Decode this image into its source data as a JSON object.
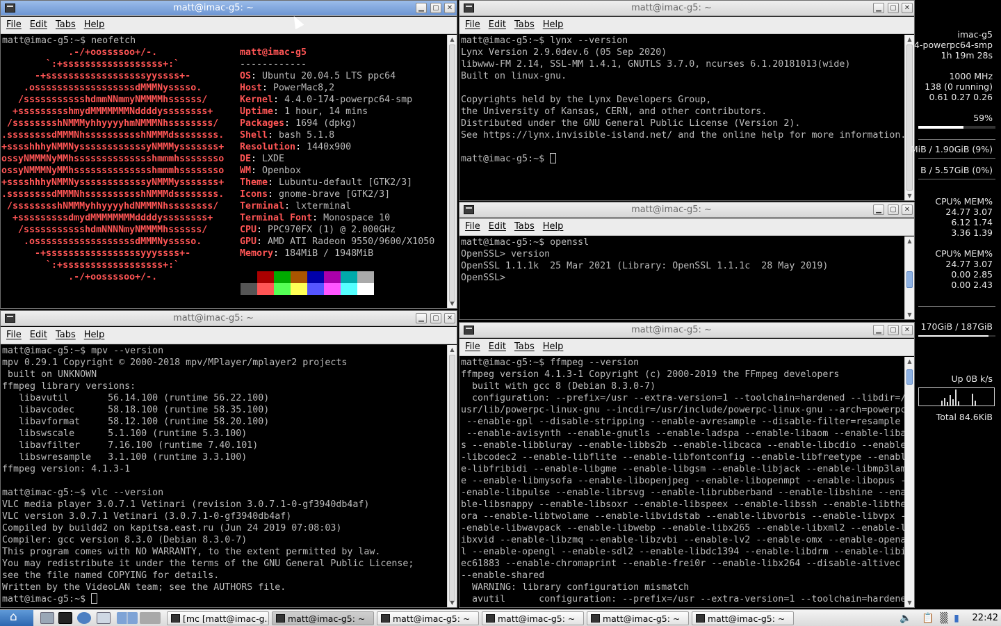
{
  "menu": [
    "File",
    "Edit",
    "Tabs",
    "Help"
  ],
  "windows": {
    "neofetch": {
      "title": "matt@imac-g5: ~",
      "prompt": "matt@imac-g5:~$ neofetch",
      "logo": [
        "             .-/+oossssoo+/-.",
        "         `:+ssssssssssssssssss+:`",
        "       -+ssssssssssssssssssyyssss+-",
        "     .ossssssssssssssssssdMMMNysssso.",
        "    /ssssssssssshdmmNNmmyNMMMMhssssss/",
        "   +ssssssssshmydMMMMMMMNddddyssssssss+",
        "  /sssssssshNMMMyhhyyyyhmNMMMNhssssssss/",
        " .ssssssssdMMMNhsssssssssshNMMMdssssssss.",
        " +sssshhhyNMMNyssssssssssssyNMMMysssssss+",
        " ossyNMMMNyMMhsssssssssssssshmmmhssssssso",
        " ossyNMMMNyMMhsssssssssssssshmmmhssssssso",
        " +sssshhhyNMMNyssssssssssssyNMMMysssssss+",
        " .ssssssssdMMMNhsssssssssshNMMMdssssssss.",
        "  /sssssssshNMMMyhhyyyyhdNMMMNhssssssss/",
        "   +sssssssssdmydMMMMMMMMddddyssssssss+",
        "    /ssssssssssshdmNNNNmyNMMMMhssssss/",
        "     .ossssssssssssssssssdMMMNysssso.",
        "       -+sssssssssssssssssyyyssss+-",
        "         `:+ssssssssssssssssss+:`",
        "             .-/+oossssoo+/-."
      ],
      "user_host": "matt@imac-g5",
      "separator": "------------",
      "info": [
        {
          "label": "OS",
          "value": "Ubuntu 20.04.5 LTS ppc64"
        },
        {
          "label": "Host",
          "value": "PowerMac8,2"
        },
        {
          "label": "Kernel",
          "value": "4.4.0-174-powerpc64-smp"
        },
        {
          "label": "Uptime",
          "value": "1 hour, 14 mins"
        },
        {
          "label": "Packages",
          "value": "1694 (dpkg)"
        },
        {
          "label": "Shell",
          "value": "bash 5.1.8"
        },
        {
          "label": "Resolution",
          "value": "1440x900"
        },
        {
          "label": "DE",
          "value": "LXDE"
        },
        {
          "label": "WM",
          "value": "Openbox"
        },
        {
          "label": "Theme",
          "value": "Lubuntu-default [GTK2/3]"
        },
        {
          "label": "Icons",
          "value": "gnome-brave [GTK2/3]"
        },
        {
          "label": "Terminal",
          "value": "lxterminal"
        },
        {
          "label": "Terminal Font",
          "value": "Monospace 10"
        },
        {
          "label": "CPU",
          "value": "PPC970FX (1) @ 2.000GHz"
        },
        {
          "label": "GPU",
          "value": "AMD ATI Radeon 9550/9600/X1050"
        },
        {
          "label": "Memory",
          "value": "184MiB / 1948MiB"
        }
      ],
      "palette_dark": [
        "#000000",
        "#aa0000",
        "#00aa00",
        "#aa5500",
        "#0000aa",
        "#aa00aa",
        "#00aaaa",
        "#aaaaaa"
      ],
      "palette_bright": [
        "#555555",
        "#ff5555",
        "#55ff55",
        "#ffff55",
        "#5555ff",
        "#ff55ff",
        "#55ffff",
        "#ffffff"
      ]
    },
    "mpv": {
      "title": "matt@imac-g5: ~",
      "text": "matt@imac-g5:~$ mpv --version\nmpv 0.29.1 Copyright © 2000-2018 mpv/MPlayer/mplayer2 projects\n built on UNKNOWN\nffmpeg library versions:\n   libavutil       56.14.100 (runtime 56.22.100)\n   libavcodec      58.18.100 (runtime 58.35.100)\n   libavformat     58.12.100 (runtime 58.20.100)\n   libswscale      5.1.100 (runtime 5.3.100)\n   libavfilter     7.16.100 (runtime 7.40.101)\n   libswresample   3.1.100 (runtime 3.3.100)\nffmpeg version: 4.1.3-1\n\nmatt@imac-g5:~$ vlc --version\nVLC media player 3.0.7.1 Vetinari (revision 3.0.7.1-0-gf3940db4af)\nVLC version 3.0.7.1 Vetinari (3.0.7.1-0-gf3940db4af)\nCompiled by buildd2 on kapitsa.east.ru (Jun 24 2019 07:08:03)\nCompiler: gcc version 8.3.0 (Debian 8.3.0-7)\nThis program comes with NO WARRANTY, to the extent permitted by law.\nYou may redistribute it under the terms of the GNU General Public License;\nsee the file named COPYING for details.\nWritten by the VideoLAN team; see the AUTHORS file.",
      "prompt": "matt@imac-g5:~$ "
    },
    "lynx": {
      "title": "matt@imac-g5: ~",
      "text": "matt@imac-g5:~$ lynx --version\nLynx Version 2.9.0dev.6 (05 Sep 2020)\nlibwww-FM 2.14, SSL-MM 1.4.1, GNUTLS 3.7.0, ncurses 6.1.20181013(wide)\nBuilt on linux-gnu.\n\nCopyrights held by the Lynx Developers Group,\nthe University of Kansas, CERN, and other contributors.\nDistributed under the GNU General Public License (Version 2).\nSee https://lynx.invisible-island.net/ and the online help for more information.\n\n",
      "prompt": "matt@imac-g5:~$ "
    },
    "openssl": {
      "title": "matt@imac-g5: ~",
      "text": "matt@imac-g5:~$ openssl\nOpenSSL> version\nOpenSSL 1.1.1k  25 Mar 2021 (Library: OpenSSL 1.1.1c  28 May 2019)\nOpenSSL>"
    },
    "ffmpeg": {
      "title": "matt@imac-g5: ~",
      "text": "matt@imac-g5:~$ ffmpeg --version\nffmpeg version 4.1.3-1 Copyright (c) 2000-2019 the FFmpeg developers\n  built with gcc 8 (Debian 8.3.0-7)\n  configuration: --prefix=/usr --extra-version=1 --toolchain=hardened --libdir=/\nusr/lib/powerpc-linux-gnu --incdir=/usr/include/powerpc-linux-gnu --arch=powerpc\n --enable-gpl --disable-stripping --enable-avresample --disable-filter=resample\n --enable-avisynth --enable-gnutls --enable-ladspa --enable-libaom --enable-libas\ns --enable-libbluray --enable-libbs2b --enable-libcaca --enable-libcdio --enable\n-libcodec2 --enable-libflite --enable-libfontconfig --enable-libfreetype --enabl\ne-libfribidi --enable-libgme --enable-libgsm --enable-libjack --enable-libmp3lam\ne --enable-libmysofa --enable-libopenjpeg --enable-libopenmpt --enable-libopus -\n-enable-libpulse --enable-librsvg --enable-librubberband --enable-libshine --ena\nble-libsnappy --enable-libsoxr --enable-libspeex --enable-libssh --enable-libthe\nora --enable-libtwolame --enable-libvidstab --enable-libvorbis --enable-libvpx -\n-enable-libwavpack --enable-libwebp --enable-libx265 --enable-libxml2 --enable-l\nibxvid --enable-libzmq --enable-libzvbi --enable-lv2 --enable-omx --enable-opena\nl --enable-opengl --enable-sdl2 --enable-libdc1394 --enable-libdrm --enable-libi\nec61883 --enable-chromaprint --enable-frei0r --enable-libx264 --disable-altivec\n--enable-shared\n  WARNING: library configuration mismatch\n  avutil      configuration: --prefix=/usr --extra-version=1 --toolchain=hardene"
    }
  },
  "conky": {
    "hostname": "imac-g5",
    "kernel": "4-powerpc64-smp",
    "uptime": "1h 19m 28s",
    "freq": "1000 MHz",
    "procs": "138 (0 running)",
    "load": "0.61 0.27 0.26",
    "cpu_percent": "59%",
    "cpu_fraction": 0.59,
    "mem": "MiB / 1.90GiB (9%)",
    "mem_fraction": 0.09,
    "swap": "B  / 5.57GiB (0%)",
    "swap_fraction": 0.0,
    "proc_header": "CPU% MEM%",
    "cpu_rows": [
      "24.77  3.07",
      "6.12  1.74",
      "3.36  1.39"
    ],
    "mem_rows": [
      "24.77  3.07",
      "0.00  2.85",
      "0.00  2.43"
    ],
    "disk": "170GiB / 187GiB",
    "disk_fraction": 0.91,
    "net_up": "Up 0B    k/s",
    "net_total": "Total 84.6KiB"
  },
  "taskbar": {
    "tasks": [
      "[mc [matt@imac-g...",
      "matt@imac-g5: ~",
      "matt@imac-g5: ~",
      "matt@imac-g5: ~",
      "matt@imac-g5: ~",
      "matt@imac-g5: ~"
    ],
    "clock": "22:42"
  }
}
